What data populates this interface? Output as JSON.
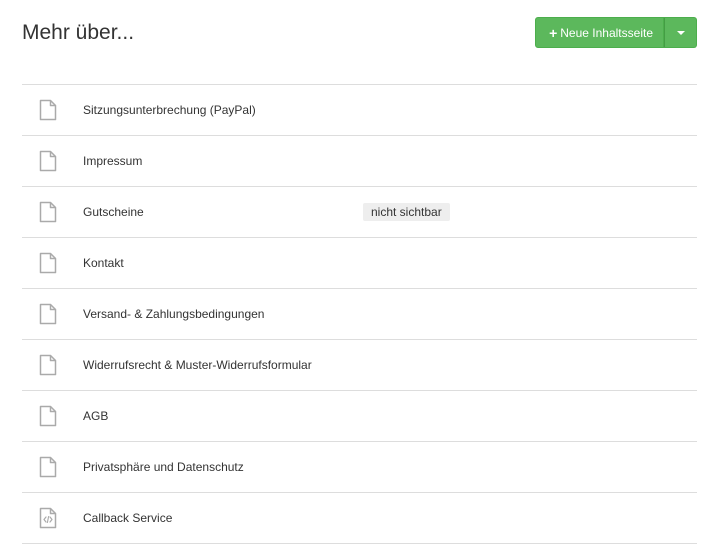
{
  "page": {
    "title": "Mehr über..."
  },
  "toolbar": {
    "new_button_label": "Neue Inhaltsseite"
  },
  "pages": [
    {
      "label": "Sitzungsunterbrechung (PayPal)",
      "icon": "file-icon"
    },
    {
      "label": "Impressum",
      "icon": "file-icon"
    },
    {
      "label": "Gutscheine",
      "icon": "file-icon",
      "badge": "nicht sichtbar"
    },
    {
      "label": "Kontakt",
      "icon": "file-icon"
    },
    {
      "label": "Versand- & Zahlungsbedingungen",
      "icon": "file-icon"
    },
    {
      "label": "Widerrufsrecht & Muster-Widerrufsformular",
      "icon": "file-icon"
    },
    {
      "label": "AGB",
      "icon": "file-icon"
    },
    {
      "label": "Privatsphäre und Datenschutz",
      "icon": "file-icon"
    },
    {
      "label": "Callback Service",
      "icon": "file-code-icon"
    }
  ],
  "colors": {
    "primary_button": "#5cb85c",
    "icon": "#aaaaaa",
    "border": "#dddddd",
    "badge_bg": "#eeeeee"
  }
}
